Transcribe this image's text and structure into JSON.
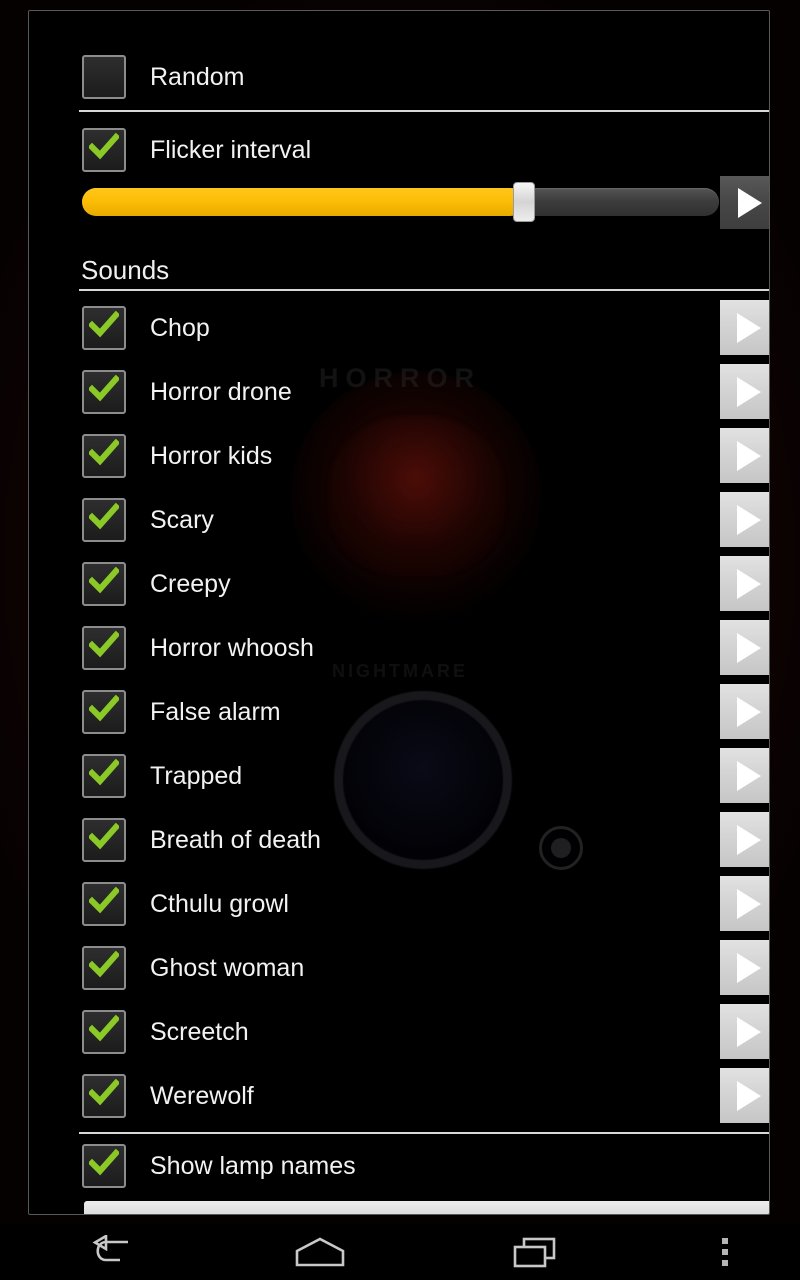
{
  "dialog": {
    "random": {
      "label": "Random",
      "checked": false
    },
    "flicker": {
      "label": "Flicker interval",
      "checked": true
    },
    "slider": {
      "value_percent": 70,
      "fill_color": "#fcbd06",
      "track_color": "#3d3d3d",
      "preview_icon": "play-icon"
    },
    "section_header": "Sounds",
    "sounds": [
      {
        "label": "Chop",
        "checked": true,
        "play_icon": "play-icon"
      },
      {
        "label": "Horror drone",
        "checked": true,
        "play_icon": "play-icon"
      },
      {
        "label": "Horror kids",
        "checked": true,
        "play_icon": "play-icon"
      },
      {
        "label": "Scary",
        "checked": true,
        "play_icon": "play-icon"
      },
      {
        "label": "Creepy",
        "checked": true,
        "play_icon": "play-icon"
      },
      {
        "label": "Horror whoosh",
        "checked": true,
        "play_icon": "play-icon"
      },
      {
        "label": "False alarm",
        "checked": true,
        "play_icon": "play-icon"
      },
      {
        "label": "Trapped",
        "checked": true,
        "play_icon": "play-icon"
      },
      {
        "label": "Breath of death",
        "checked": true,
        "play_icon": "play-icon"
      },
      {
        "label": "Cthulu growl",
        "checked": true,
        "play_icon": "play-icon"
      },
      {
        "label": "Ghost woman",
        "checked": true,
        "play_icon": "play-icon"
      },
      {
        "label": "Screetch",
        "checked": true,
        "play_icon": "play-icon"
      },
      {
        "label": "Werewolf",
        "checked": true,
        "play_icon": "play-icon"
      }
    ],
    "show_lamp_names": {
      "label": "Show lamp names",
      "checked": true
    },
    "watermark": {
      "title": "HORROR",
      "subtitle": "NIGHTMARE"
    }
  },
  "navbar": {
    "back": "back-icon",
    "home": "home-icon",
    "recents": "recents-icon",
    "menu": "overflow-menu-icon"
  }
}
